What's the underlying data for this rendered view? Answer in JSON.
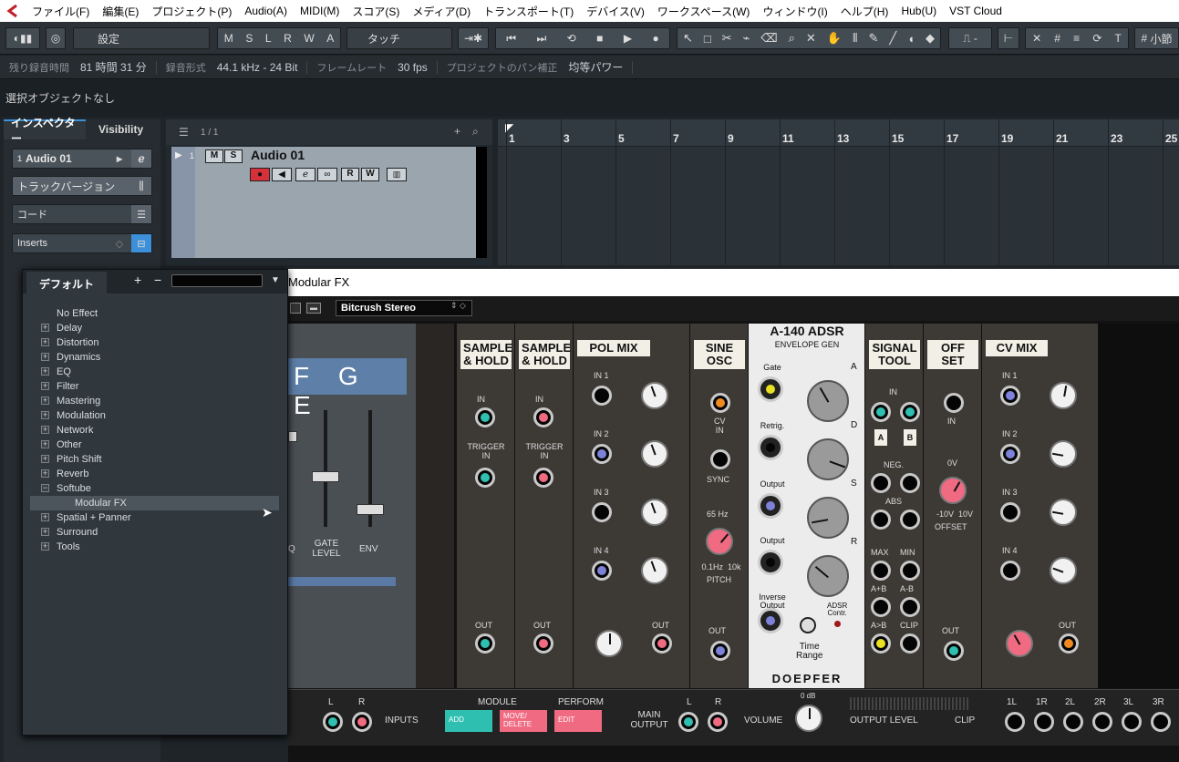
{
  "menu": [
    "ファイル(F)",
    "編集(E)",
    "プロジェクト(P)",
    "Audio(A)",
    "MIDI(M)",
    "スコア(S)",
    "メディア(D)",
    "トランスポート(T)",
    "デバイス(V)",
    "ワークスペース(W)",
    "ウィンドウ(I)",
    "ヘルプ(H)",
    "Hub(U)",
    "VST Cloud"
  ],
  "toolbar": {
    "preset": "設定",
    "msl": [
      "M",
      "S",
      "L",
      "R",
      "W",
      "A"
    ],
    "automation": "タッチ",
    "grid": "小節"
  },
  "status": {
    "rec_time_label": "残り録音時間",
    "rec_time": "81 時間 31 分",
    "rec_format_label": "録音形式",
    "rec_format": "44.1 kHz - 24 Bit",
    "frame_rate_label": "フレームレート",
    "frame_rate": "30 fps",
    "pan_label": "プロジェクトのパン補正",
    "pan": "均等パワー"
  },
  "info": "選択オブジェクトなし",
  "inspector": {
    "tab1": "インスペクター",
    "tab2": "Visibility",
    "track_num": "1",
    "track": "Audio 01",
    "versions": "トラックバージョン",
    "chord": "コード",
    "inserts": "Inserts"
  },
  "tracklist": {
    "count": "1 / 1",
    "track_num": "1",
    "track_name": "Audio 01",
    "m": "M",
    "s": "S",
    "r": "R",
    "w": "W"
  },
  "ruler": [
    "1",
    "3",
    "5",
    "7",
    "9",
    "11",
    "13",
    "15",
    "17",
    "19",
    "21",
    "23",
    "25"
  ],
  "browser": {
    "tab": "デフォルト",
    "plus": "+",
    "minus": "−",
    "items": [
      "No Effect",
      "Delay",
      "Distortion",
      "Dynamics",
      "EQ",
      "Filter",
      "Mastering",
      "Modulation",
      "Network",
      "Other",
      "Pitch Shift",
      "Reverb",
      "Softube",
      "Modular FX",
      "Spatial + Panner",
      "Surround",
      "Tools"
    ]
  },
  "plugin": {
    "title": "Modular FX",
    "preset": "Bitcrush Stereo",
    "display": "F G E",
    "fader_labels": [
      "Q",
      "GATE\nLEVEL",
      "ENV"
    ],
    "sh1": "SAMPLE\n& HOLD",
    "sh2": "SAMPLE\n& HOLD",
    "in": "IN",
    "trigger": "TRIGGER\nIN",
    "out": "OUT",
    "polmix": "POL MIX",
    "sine": "SINE\nOSC",
    "cv_in": "CV\nIN",
    "sync": "SYNC",
    "hz": "65 Hz",
    "range": "0.1Hz  10k",
    "pitch": "PITCH",
    "adsr": "A-140 ADSR",
    "env": "ENVELOPE GEN",
    "gate": "Gate",
    "retrig": "Retrig.",
    "output": "Output",
    "inv": "Inverse\nOutput",
    "adsr_contr": "ADSR\nContr.",
    "time_range": "Time\nRange",
    "doepfer": "DOEPFER",
    "signal": "SIGNAL\nTOOL",
    "neg": "NEG.",
    "abs": "ABS",
    "max": "MAX",
    "min": "MIN",
    "apb": "A+B",
    "amb": "A-B",
    "agb": "A>B",
    "clip": "CLIP",
    "offset": "OFF\nSET",
    "zerov": "0V",
    "volt": "-10V  10V",
    "offset_lbl": "OFFSET",
    "cvmix": "CV MIX",
    "bottom": {
      "l": "L",
      "r": "R",
      "inputs": "INPUTS",
      "module": "MODULE",
      "perform": "PERFORM",
      "add": "ADD",
      "move": "MOVE/\nDELETE",
      "edit": "EDIT",
      "main": "MAIN\nOUTPUT",
      "volume": "VOLUME",
      "db": "0 dB",
      "out_level": "OUTPUT LEVEL",
      "clip": "CLIP",
      "chans": [
        "1L",
        "1R",
        "2L",
        "2R",
        "3L",
        "3R"
      ]
    }
  },
  "colors": {
    "accent_blue": "#3c8fd8",
    "record": "#d8303a",
    "teal": "#2fbfb0",
    "pink": "#f06a82"
  }
}
